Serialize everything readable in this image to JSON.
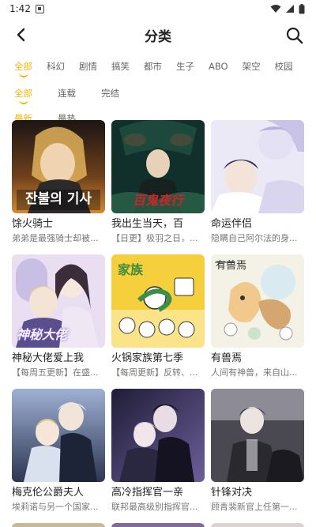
{
  "status_bar": {
    "time": "1:42"
  },
  "header": {
    "title": "分类"
  },
  "genre_tabs": [
    "全部",
    "科幻",
    "剧情",
    "搞笑",
    "都市",
    "生子",
    "ABO",
    "架空",
    "校园"
  ],
  "status_tabs": [
    "全部",
    "连载",
    "完结"
  ],
  "sort_tabs": [
    "最新",
    "最热"
  ],
  "comics": [
    {
      "title": "馀火骑士",
      "subtitle": "弟弟是最强骑士却被...",
      "cover_text": "잔불의 기사",
      "cover_colors": [
        "#2a2320",
        "#c9782c"
      ]
    },
    {
      "title": "我出生当天，百",
      "subtitle": "【日更】极羽之日，...",
      "cover_text": "百鬼夜行",
      "cover_colors": [
        "#0f2a2a",
        "#3f7d5f"
      ]
    },
    {
      "title": "命运伴侣",
      "subtitle": "隐瞒自己阿尔法的身...",
      "cover_text": "",
      "cover_colors": [
        "#c6c3ea",
        "#eaeaf7"
      ]
    },
    {
      "title": "神秘大佬爱上我",
      "subtitle": "【每周五更新】在盛...",
      "cover_text": "神秘大佬",
      "cover_colors": [
        "#b7a5d8",
        "#efe4f5"
      ]
    },
    {
      "title": "火锅家族第七季",
      "subtitle": "【每周更新】反转、...",
      "cover_text": "家族",
      "cover_colors": [
        "#f2c632",
        "#fbe89b"
      ]
    },
    {
      "title": "有兽焉",
      "subtitle": "人间有神兽，来自山...",
      "cover_text": "有兽焉",
      "cover_colors": [
        "#dbeef5",
        "#f7f0df"
      ]
    },
    {
      "title": "梅克伦公爵夫人",
      "subtitle": "埃莉诺与另一个国家...",
      "cover_text": "",
      "cover_colors": [
        "#3d4a66",
        "#c7d2e6"
      ]
    },
    {
      "title": "高冷指挥官一亲",
      "subtitle": "联邦最高级别指挥官...",
      "cover_text": "",
      "cover_colors": [
        "#2b2946",
        "#8a7bb5"
      ]
    },
    {
      "title": "针锋对决",
      "subtitle": "顾青裴新官上任第一...",
      "cover_text": "",
      "cover_colors": [
        "#3a3942",
        "#9a98a6"
      ]
    }
  ]
}
